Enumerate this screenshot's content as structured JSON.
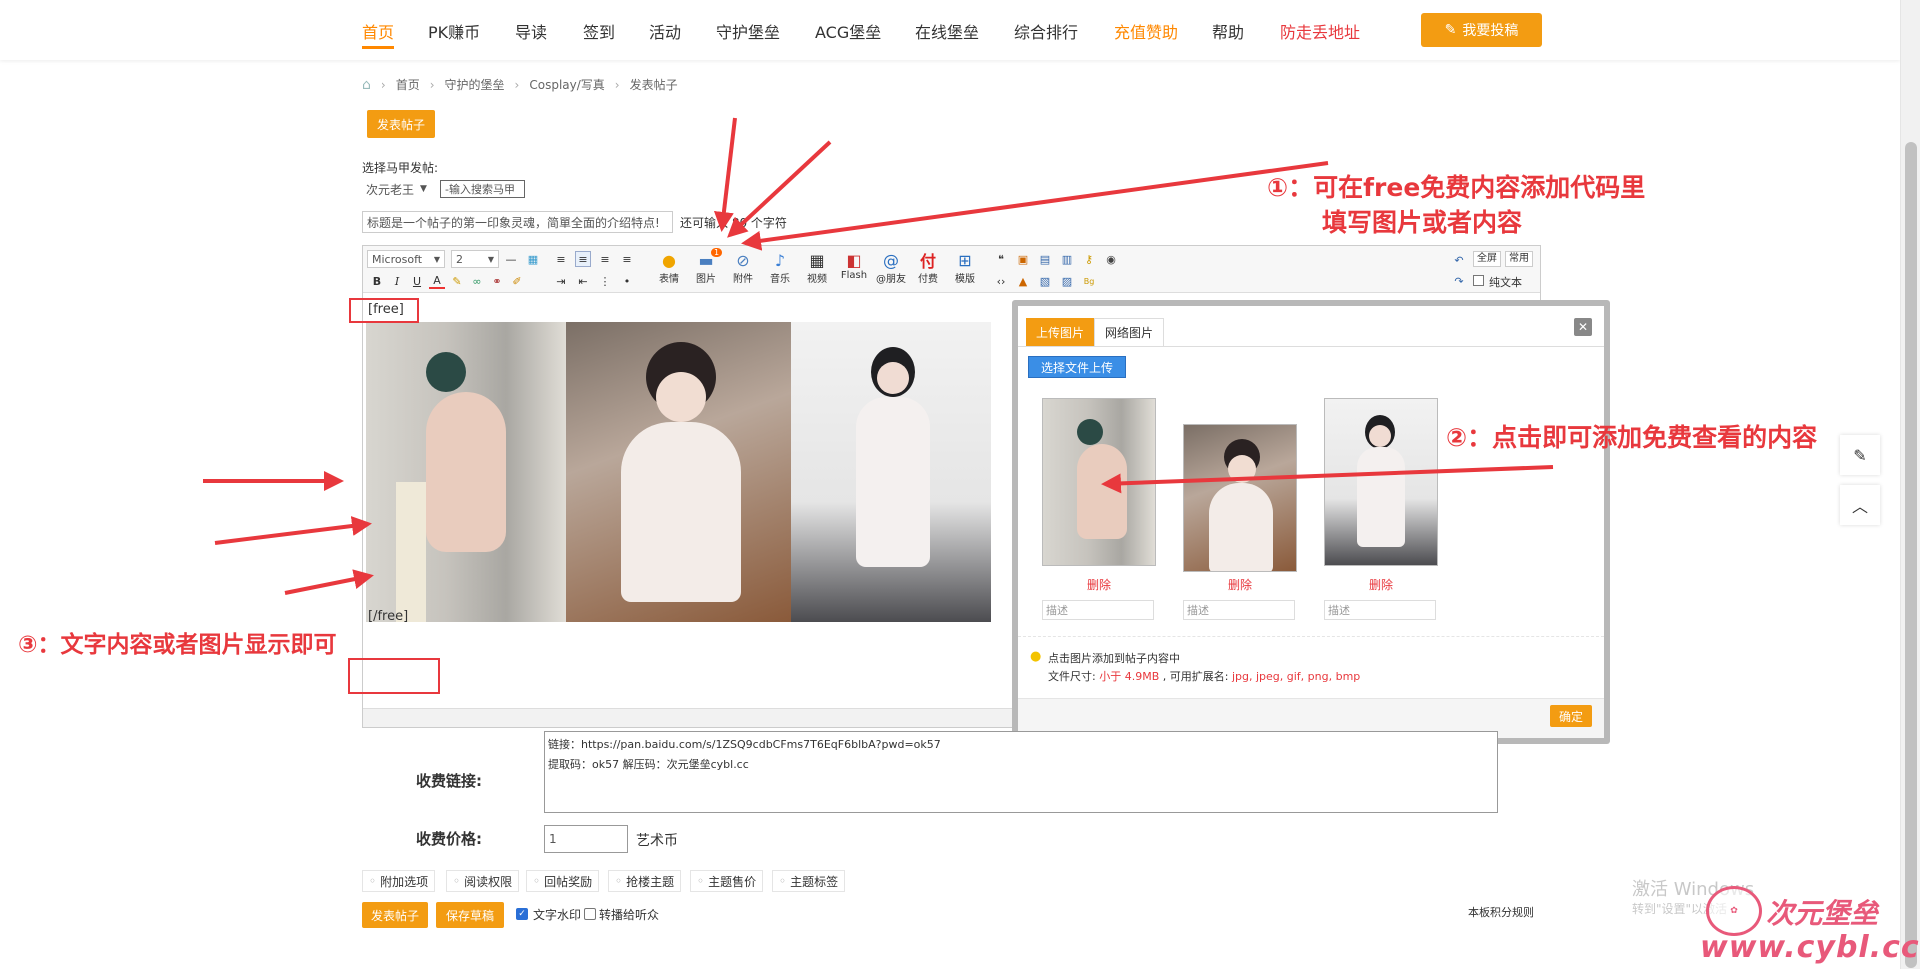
{
  "nav": {
    "items": [
      {
        "label": "首页",
        "state": "active"
      },
      {
        "label": "PK赚币",
        "state": ""
      },
      {
        "label": "导读",
        "state": ""
      },
      {
        "label": "签到",
        "state": ""
      },
      {
        "label": "活动",
        "state": ""
      },
      {
        "label": "守护堡垒",
        "state": ""
      },
      {
        "label": "ACG堡垒",
        "state": ""
      },
      {
        "label": "在线堡垒",
        "state": ""
      },
      {
        "label": "综合排行",
        "state": ""
      },
      {
        "label": "充值赞助",
        "state": "orange"
      },
      {
        "label": "帮助",
        "state": ""
      },
      {
        "label": "防走丢地址",
        "state": "red"
      }
    ],
    "post_button": "我要投稿"
  },
  "breadcrumb": [
    "首页",
    "守护的堡垒",
    "Cosplay/写真",
    "发表帖子"
  ],
  "form": {
    "tab_label": "发表帖子",
    "alias_label": "选择马甲发帖:",
    "alias_value": "次元老王",
    "alias_search": "-输入搜索马甲",
    "title_placeholder": "标题是一个帖子的第一印象灵魂，简單全面的介绍特点!",
    "title_hint": "还可输入 80 个字符"
  },
  "toolbar": {
    "font_family": "Microsoft",
    "font_size": "2",
    "buttons": [
      "表情",
      "图片",
      "附件",
      "音乐",
      "视频",
      "Flash",
      "@朋友",
      "付费",
      "模版"
    ],
    "image_badge": "1",
    "fullscreen": "全屏",
    "common": "常用",
    "plain_text": "纯文本"
  },
  "editor": {
    "free_open": "[free]",
    "free_close": "[/free]"
  },
  "dialog": {
    "tab_upload": "上传图片",
    "tab_web": "网络图片",
    "select_button": "选择文件上传",
    "delete_label": "删除",
    "desc_placeholder": "描述",
    "tip": "点击图片添加到帖子内容中",
    "size_prefix": "文件尺寸:",
    "size_value": "小于 4.9MB",
    "ext_prefix": ", 可用扩展名:",
    "ext_value": "jpg, jpeg, gif, png, bmp",
    "confirm": "确定"
  },
  "paid": {
    "link_label": "收费链接:",
    "link_line1": "链接：https://pan.baidu.com/s/1ZSQ9cdbCFms7T6EqF6blbA?pwd=ok57",
    "link_line2": "提取码：ok57 解压码：次元堡垒cybl.cc",
    "price_label": "收费价格:",
    "price_value": "1",
    "price_unit": "艺术币"
  },
  "options": [
    "附加选项",
    "阅读权限",
    "回帖奖励",
    "抢楼主题",
    "主题售价",
    "主题标签"
  ],
  "bottom": {
    "submit": "发表帖子",
    "draft": "保存草稿",
    "watermark": "文字水印",
    "forward": "转播给听众",
    "rules": "本板积分规则"
  },
  "annotations": {
    "a1_line1": "①：可在free免费内容添加代码里",
    "a1_line2": "填写图片或者内容",
    "a2": "②：点击即可添加免费查看的内容",
    "a3": "③：文字内容或者图片显示即可"
  },
  "windows": {
    "activate": "激活 Windows",
    "goto": "转到\"设置\"以激活"
  },
  "watermark": {
    "name": "次元堡垒",
    "url": "www.cybl.cc"
  },
  "colors": {
    "accent": "#f39c12",
    "annotation": "#e8383d"
  }
}
